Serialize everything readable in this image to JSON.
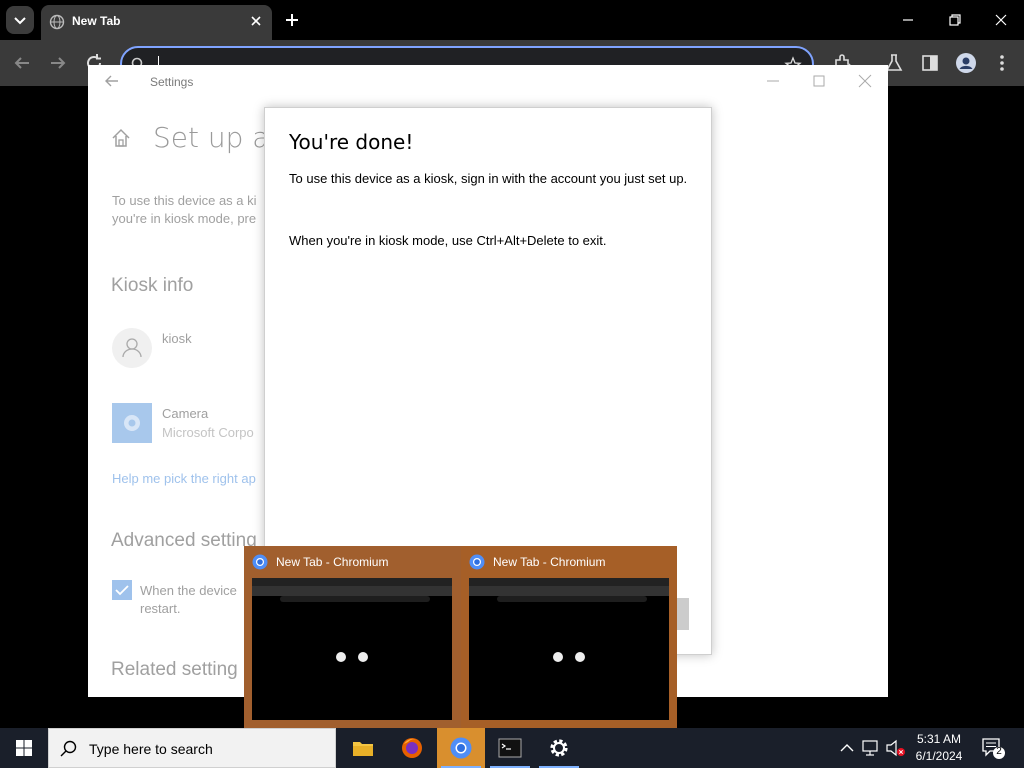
{
  "browser": {
    "tab_title": "New Tab",
    "omnibox_value": ""
  },
  "settings": {
    "window_title": "Settings",
    "heading": "Set up a k",
    "intro_line1": "To use this device as a ki",
    "intro_line2": "you're in kiosk mode, pre",
    "kiosk_info_heading": "Kiosk info",
    "account_name": "kiosk",
    "app_name": "Camera",
    "app_publisher": "Microsoft Corpo",
    "help_link": "Help me pick the right ap",
    "advanced_heading": "Advanced setting",
    "checkbox_line1": "When the device",
    "checkbox_line2": "restart.",
    "related_heading": "Related setting"
  },
  "dialog": {
    "title": "You're done!",
    "body_line1": "To use this device as a kiosk, sign in with the account you just set up.",
    "body_line2": "When you're in kiosk mode, use Ctrl+Alt+Delete to exit."
  },
  "thumbnails": [
    {
      "title": "New Tab - Chromium"
    },
    {
      "title": "New Tab - Chromium"
    }
  ],
  "taskbar": {
    "search_placeholder": "Type here to search",
    "time": "5:31 AM",
    "date": "6/1/2024",
    "notification_count": "2"
  },
  "colors": {
    "thumbnail_bg": "#a15f2e",
    "accent_blue": "#7fa3ff",
    "taskbar_bg": "#1a1f2a"
  }
}
